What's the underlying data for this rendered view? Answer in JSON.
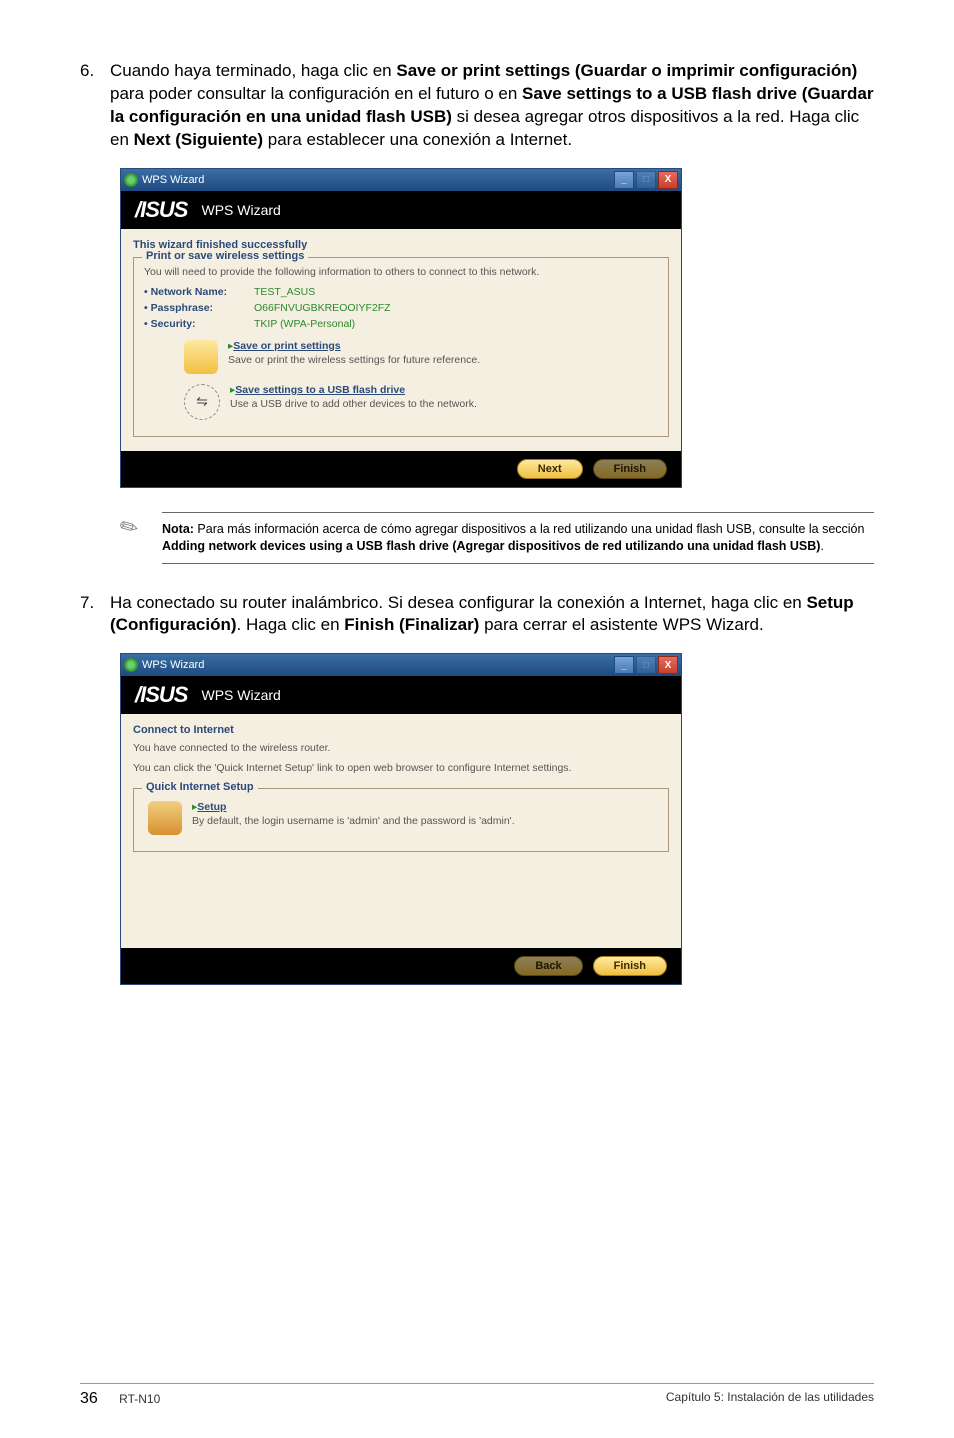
{
  "step6": {
    "num": "6.",
    "pre": "Cuando haya terminado, haga clic en ",
    "b1": "Save or print settings (Guardar o imprimir configuración)",
    "mid1": " para poder consultar la configuración en el futuro o en ",
    "b2": "Save settings to a USB flash drive (Guardar la configuración en una unidad flash USB)",
    "mid2": " si desea agregar otros dispositivos a la red. Haga clic en ",
    "b3": "Next (Siguiente)",
    "post": " para establecer una conexión a Internet."
  },
  "dialog1": {
    "title": "WPS Wizard",
    "wizardTitle": "WPS Wizard",
    "heading": "This wizard finished successfully",
    "fieldsetLegend": "Print or save wireless settings",
    "fsText": "You will need to provide the following information to others to connect to this network.",
    "rows": [
      {
        "k": "Network Name:",
        "v": "TEST_ASUS"
      },
      {
        "k": "Passphrase:",
        "v": "O66FNVUGBKREOOIYF2FZ"
      },
      {
        "k": "Security:",
        "v": "TKIP (WPA-Personal)"
      }
    ],
    "saveLink": "Save or print settings",
    "saveSub": "Save or print the wireless settings for future reference.",
    "usbLink": "Save settings to a USB flash drive",
    "usbSub": "Use a USB drive to add other devices to the network.",
    "btnNext": "Next",
    "btnFinish": "Finish"
  },
  "note": {
    "lead": "Nota:",
    "t1": " Para más información acerca de cómo agregar dispositivos a la red utilizando una unidad flash USB, consulte la sección ",
    "b1": "Adding network devices using a USB flash drive (Agregar dispositivos de red utilizando una unidad flash USB)",
    "t2": "."
  },
  "step7": {
    "num": "7.",
    "pre": "Ha conectado su router inalámbrico. Si desea configurar la conexión a Internet, haga clic en ",
    "b1": "Setup (Configuración)",
    "mid1": ". Haga clic en ",
    "b2": "Finish (Finalizar)",
    "post": " para cerrar el asistente WPS Wizard."
  },
  "dialog2": {
    "title": "WPS Wizard",
    "wizardTitle": "WPS Wizard",
    "heading": "Connect to Internet",
    "line1": "You have connected to the wireless router.",
    "line2": "You can click the 'Quick Internet Setup' link to open web browser to configure Internet settings.",
    "fieldsetLegend": "Quick Internet Setup",
    "setupLink": "Setup",
    "setupSub": "By default, the login username is 'admin' and the password is 'admin'.",
    "btnBack": "Back",
    "btnFinish": "Finish"
  },
  "footer": {
    "page": "36",
    "model": "RT-N10",
    "chapter": "Capítulo 5: Instalación de las utilidades"
  },
  "win": {
    "min": "_",
    "max": "□",
    "close": "X"
  }
}
